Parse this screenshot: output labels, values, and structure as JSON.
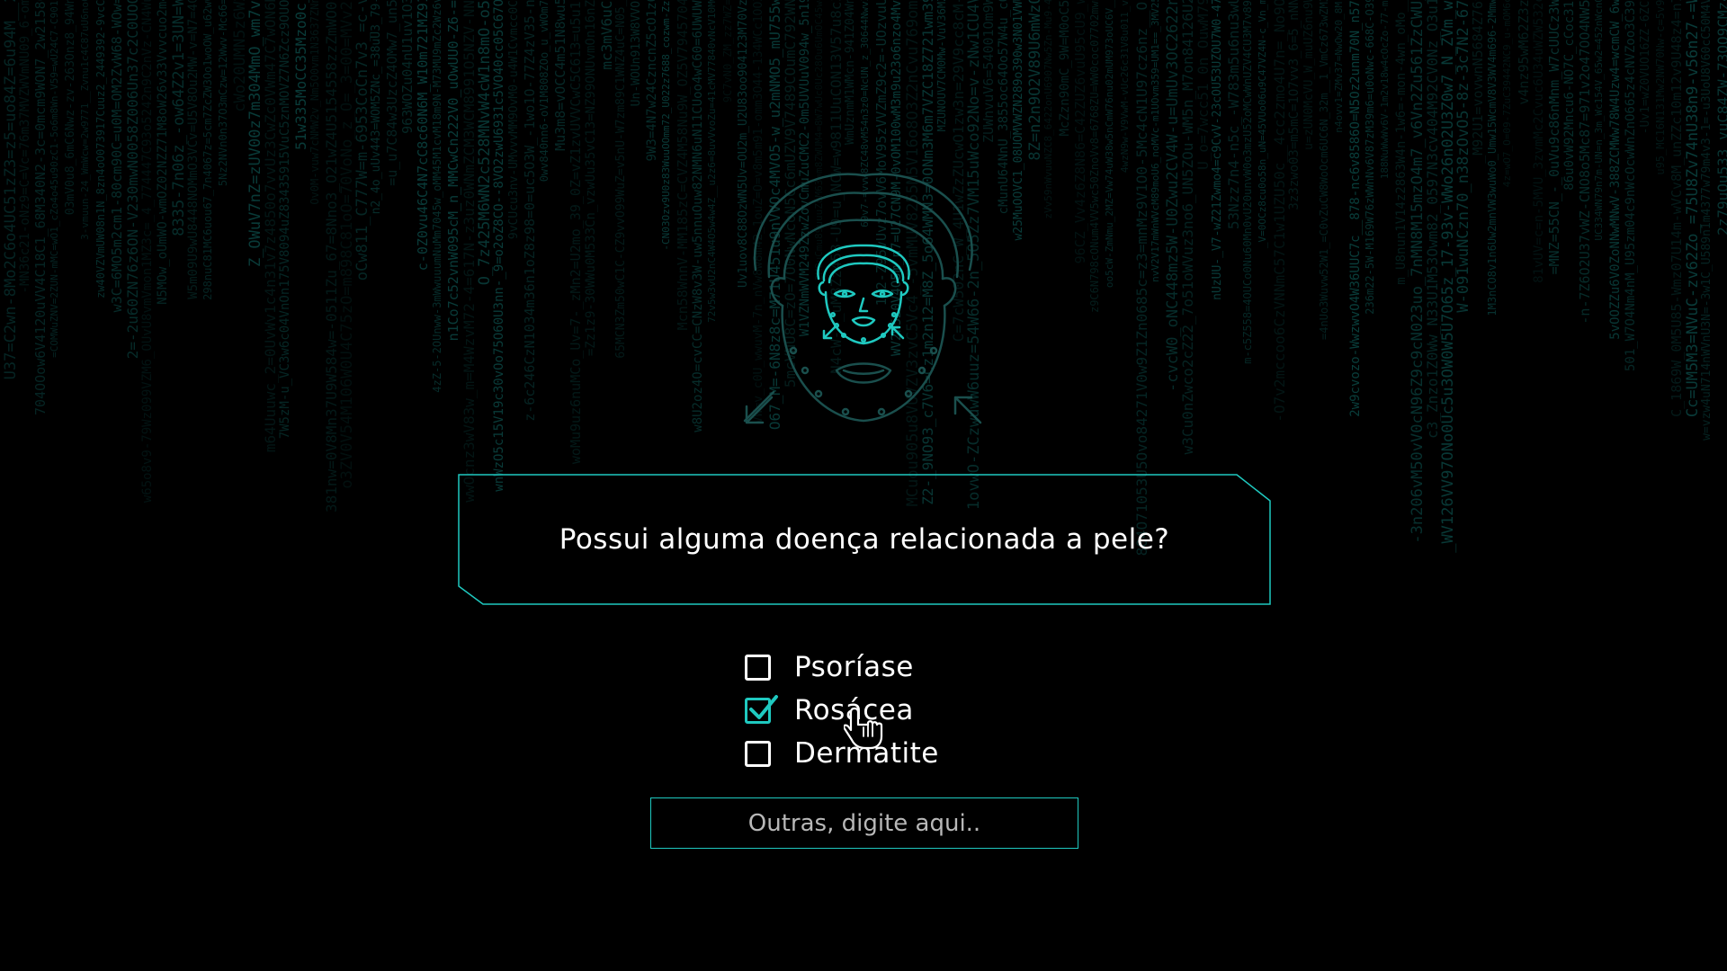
{
  "colors": {
    "accent": "#1fc9c0",
    "background": "#000000",
    "text": "#ffffff"
  },
  "illustration": {
    "icon": "face-scan-icon"
  },
  "question": {
    "text": "Possui alguma doença relacionada a pele?"
  },
  "options": [
    {
      "label": "Psoríase",
      "checked": false
    },
    {
      "label": "Rosácea",
      "checked": true
    },
    {
      "label": "Dermatite",
      "checked": false
    }
  ],
  "other_input": {
    "placeholder": "Outras, digite aqui..",
    "value": ""
  },
  "cursor": {
    "icon": "hand-pointer-icon"
  }
}
